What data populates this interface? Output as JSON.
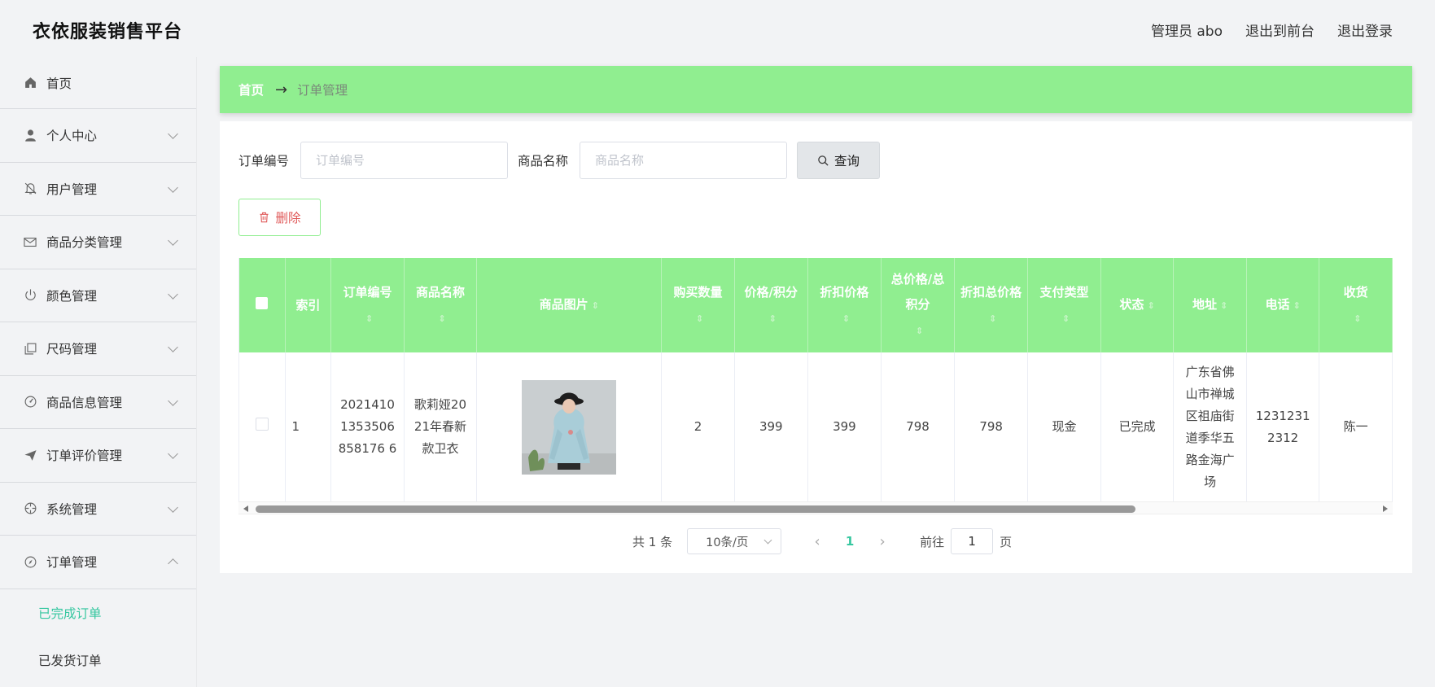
{
  "header": {
    "brand": "衣依服装销售平台",
    "admin_label": "管理员 abo",
    "back_to_front": "退出到前台",
    "logout": "退出登录"
  },
  "sidebar": {
    "items": [
      {
        "label": "首页",
        "icon": "home-icon"
      },
      {
        "label": "个人中心",
        "icon": "user-icon"
      },
      {
        "label": "用户管理",
        "icon": "bell-off-icon"
      },
      {
        "label": "商品分类管理",
        "icon": "mail-icon"
      },
      {
        "label": "颜色管理",
        "icon": "power-icon"
      },
      {
        "label": "尺码管理",
        "icon": "copy-icon"
      },
      {
        "label": "商品信息管理",
        "icon": "gauge-icon"
      },
      {
        "label": "订单评价管理",
        "icon": "send-icon"
      },
      {
        "label": "系统管理",
        "icon": "crosshair-icon"
      },
      {
        "label": "订单管理",
        "icon": "compass-icon"
      }
    ],
    "sub_items": [
      {
        "label": "已完成订单",
        "active": true
      },
      {
        "label": "已发货订单",
        "active": false
      }
    ]
  },
  "breadcrumb": {
    "home": "首页",
    "arrow": "→",
    "current": "订单管理"
  },
  "search": {
    "order_no_label": "订单编号",
    "order_no_placeholder": "订单编号",
    "product_name_label": "商品名称",
    "product_name_placeholder": "商品名称",
    "query_button": "查询"
  },
  "actions": {
    "delete_button": "删除"
  },
  "table": {
    "columns": [
      "索引",
      "订单编号",
      "商品名称",
      "商品图片",
      "购买数量",
      "价格/积分",
      "折扣价格",
      "总价格/总积分",
      "折扣总价格",
      "支付类型",
      "状态",
      "地址",
      "电话",
      "收货"
    ],
    "rows": [
      {
        "index": "1",
        "order_no": "20214101353506858176 6",
        "product_name": "歌莉娅2021年春新款卫衣",
        "quantity": "2",
        "price": "399",
        "discount_price": "399",
        "total_price": "798",
        "discount_total": "798",
        "pay_type": "现金",
        "status": "已完成",
        "address": "广东省佛山市禅城区祖庙街道季华五路金海广场",
        "phone": "12312312312",
        "receiver": "陈一"
      }
    ]
  },
  "pagination": {
    "total": "共 1 条",
    "page_size": "10条/页",
    "current_page": "1",
    "goto_label": "前往",
    "goto_value": "1",
    "page_suffix": "页"
  },
  "colors": {
    "accent_green": "#90ee90",
    "active_teal": "#36c7a0",
    "danger": "#e05a5a"
  }
}
